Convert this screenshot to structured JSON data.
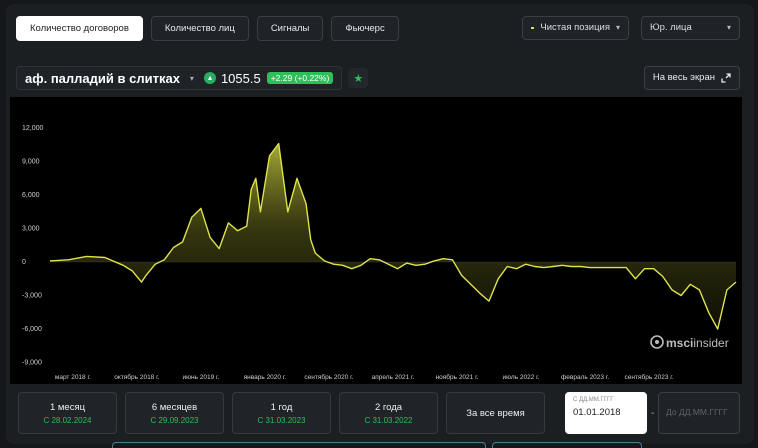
{
  "tabs": [
    {
      "label": "Количество договоров",
      "active": true
    },
    {
      "label": "Количество лиц",
      "active": false
    },
    {
      "label": "Сигналы",
      "active": false
    },
    {
      "label": "Фьючерс",
      "active": false
    }
  ],
  "filters": {
    "position_select": "Чистая позиция",
    "entity_select": "Юр. лица"
  },
  "asset": {
    "name": "аф. палладий в слитках",
    "price": "1055.5",
    "change": "+2.29 (+0.22%)",
    "fullscreen_label": "На весь экран"
  },
  "periods": [
    {
      "label": "1 месяц",
      "date": "С 28.02.2024"
    },
    {
      "label": "6 месяцев",
      "date": "С 29.09.2023"
    },
    {
      "label": "1 год",
      "date": "С 31.03.2023"
    },
    {
      "label": "2 года",
      "date": "С 31.03.2022"
    },
    {
      "label": "За все время",
      "date": ""
    }
  ],
  "date_range": {
    "from_placeholder": "С ДД.ММ.ГГГГ",
    "from_value": "01.01.2018",
    "to_placeholder": "До ДД.ММ.ГГГГ"
  },
  "watermark": "msci",
  "watermark_brand": "insider",
  "colors": {
    "line": "#dfe34a",
    "positive": "#2fbf5a"
  },
  "chart_data": {
    "type": "area",
    "y_ticks": [
      "12,000",
      "9,000",
      "6,000",
      "3,000",
      "0",
      "-3,000",
      "-6,000",
      "-9,000"
    ],
    "x_ticks": [
      "март 2018 г.",
      "октябрь 2018 г.",
      "июнь 2019 г.",
      "январь 2020 г.",
      "сентябрь 2020 г.",
      "апрель 2021 г.",
      "ноябрь 2021 г.",
      "июль 2022 г.",
      "февраль 2023 г.",
      "сентябрь 2023 г."
    ],
    "ylim": [
      -9000,
      13000
    ],
    "x": [
      0,
      4,
      8,
      12,
      16,
      18,
      20,
      21,
      23,
      25,
      27,
      29,
      31,
      33,
      35,
      37,
      39,
      41,
      43,
      44,
      45,
      46,
      48,
      50,
      52,
      54,
      56,
      57,
      58,
      60,
      62,
      64,
      66,
      68,
      70,
      72,
      74,
      76,
      78,
      80,
      82,
      84,
      86,
      88,
      90,
      92,
      94,
      96,
      98,
      100,
      102,
      104,
      106,
      108,
      110,
      112,
      114,
      116,
      118,
      120,
      122,
      124,
      126,
      128,
      130,
      132,
      134,
      136,
      138,
      140,
      142,
      144,
      146,
      148,
      150
    ],
    "values": [
      100,
      200,
      500,
      400,
      -300,
      -800,
      -1800,
      -1200,
      -200,
      200,
      1300,
      1800,
      4000,
      4800,
      2200,
      1200,
      3500,
      2800,
      3200,
      6500,
      7500,
      4500,
      9500,
      10600,
      4500,
      7500,
      5200,
      2000,
      800,
      100,
      -200,
      -300,
      -600,
      -300,
      300,
      200,
      -200,
      -600,
      -100,
      -300,
      -200,
      100,
      300,
      200,
      -1200,
      -2000,
      -2800,
      -3500,
      -1500,
      -400,
      -600,
      -200,
      -400,
      -500,
      -400,
      -300,
      -400,
      -400,
      -500,
      -500,
      -500,
      -500,
      -500,
      -1500,
      -600,
      -600,
      -1300,
      -2500,
      -3000,
      -2000,
      -2500,
      -4500,
      -6000,
      -2500,
      -1800
    ]
  }
}
